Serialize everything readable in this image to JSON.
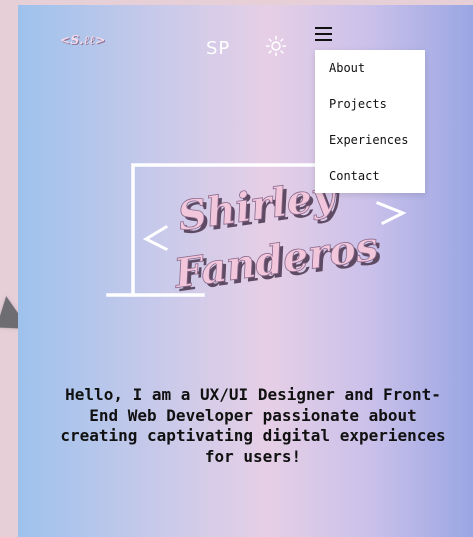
{
  "header": {
    "logo_text": "<S.ℓℓ>",
    "initials": "SP",
    "theme_icon": "sun-icon",
    "menu_icon": "hamburger-menu-icon"
  },
  "menu": {
    "items": [
      {
        "label": "About"
      },
      {
        "label": "Projects"
      },
      {
        "label": "Experiences"
      },
      {
        "label": "Contact"
      }
    ]
  },
  "hero": {
    "first_name": "Shirley",
    "last_name": "Fanderos",
    "intro": "Hello, I am a UX/UI Designer and Front-End Web Developer passionate about creating captivating digital experiences for users!"
  },
  "colors": {
    "gradient": [
      "#9ec2ec",
      "#e6cfe6",
      "#9aa6e3"
    ],
    "name_fill": "#f2c7dc",
    "name_shadow": "#5e4a63",
    "frame_line": "#ffffff"
  }
}
